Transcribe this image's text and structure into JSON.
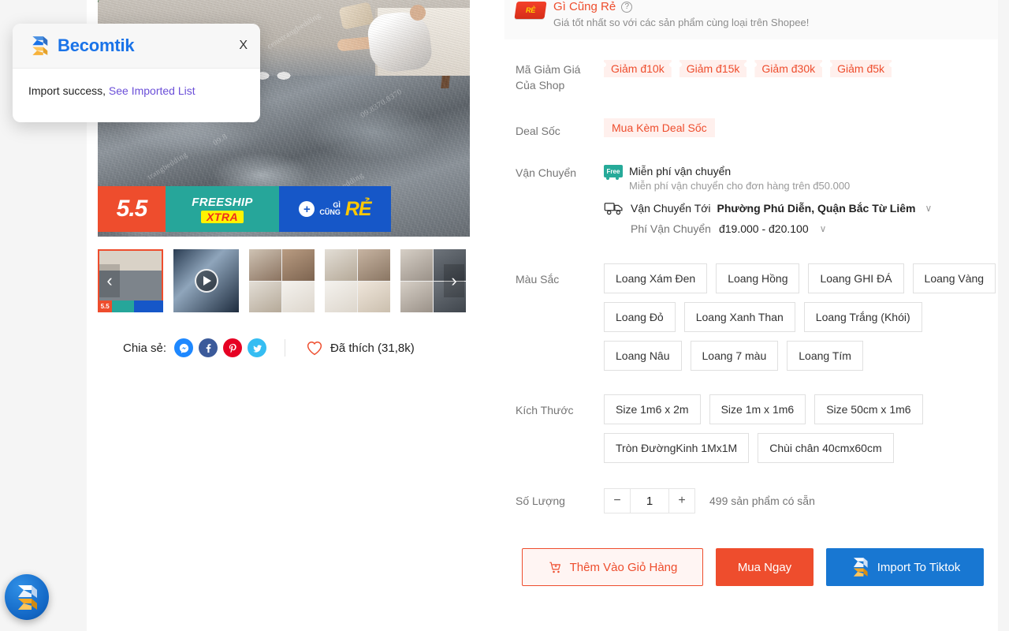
{
  "toast": {
    "brand": "Becomtik",
    "close_label": "X",
    "message_prefix": "Import success,",
    "link_text": "See Imported List"
  },
  "gallery": {
    "prev_arrow": "‹",
    "next_arrow": "›",
    "promo": {
      "campaign": "5.5",
      "freeship": "FREESHIP",
      "xtra": "XTRA",
      "plus": "+",
      "gi": "GÌ",
      "cung": "CŨNG",
      "re": "RẺ"
    },
    "thumb_badge": "5.5",
    "watermarks": [
      "cenotrangbedding",
      "09.8370.8370",
      "trangbedding",
      "09.8",
      "ngbedding"
    ]
  },
  "share": {
    "label": "Chia sẻ:",
    "icons": [
      "messenger-icon",
      "facebook-icon",
      "pinterest-icon",
      "twitter-icon"
    ],
    "like_text": "Đã thích (31,8k)"
  },
  "best_price": {
    "logo_text": "RẺ",
    "title": "Gì Cũng Rẻ",
    "help": "?",
    "subtitle": "Giá tốt nhất so với các sản phẩm cùng loại trên Shopee!"
  },
  "vouchers": {
    "label_line1": "Mã Giảm Giá",
    "label_line2": "Của Shop",
    "items": [
      "Giảm đ10k",
      "Giảm đ15k",
      "Giảm đ30k",
      "Giảm đ5k"
    ]
  },
  "deal": {
    "label": "Deal Sốc",
    "tag": "Mua Kèm Deal Sốc"
  },
  "shipping": {
    "label": "Vận Chuyển",
    "free_badge": "Free",
    "free_title": "Miễn phí vận chuyển",
    "free_sub": "Miễn phí vận chuyển cho đơn hàng trên đ50.000",
    "ship_to_label": "Vận Chuyển Tới",
    "ship_to_value": "Phường Phú Diễn, Quận Bắc Từ Liêm",
    "fee_label": "Phí Vận Chuyển",
    "fee_value": "đ19.000 - đ20.100",
    "caret": "∨"
  },
  "color": {
    "label": "Màu Sắc",
    "options": [
      "Loang Xám Đen",
      "Loang Hồng",
      "Loang GHI ĐÁ",
      "Loang Vàng",
      "Loang Đỏ",
      "Loang Xanh Than",
      "Loang Trắng (Khói)",
      "Loang Nâu",
      "Loang 7 màu",
      "Loang Tím"
    ]
  },
  "size": {
    "label": "Kích Thước",
    "options": [
      "Size 1m6 x 2m",
      "Size 1m x 1m6",
      "Size 50cm x 1m6",
      "Tròn ĐườngKinh 1Mx1M",
      "Chùi chân 40cmx60cm"
    ]
  },
  "quantity": {
    "label": "Số Lượng",
    "minus": "−",
    "value": "1",
    "plus": "+",
    "stock": "499 sản phẩm có sẵn"
  },
  "cta": {
    "add_to_cart": "Thêm Vào Giỏ Hàng",
    "buy_now": "Mua Ngay",
    "import": "Import To Tiktok"
  },
  "colors": {
    "shopee_orange": "#ee4d2d",
    "becomtik_blue": "#1877d2",
    "brand_blue": "#1a73e8",
    "link_purple": "#6b4fd8",
    "teal": "#26a69a",
    "banner_blue": "#1657c8",
    "voucher_bg": "#fff0ed"
  }
}
